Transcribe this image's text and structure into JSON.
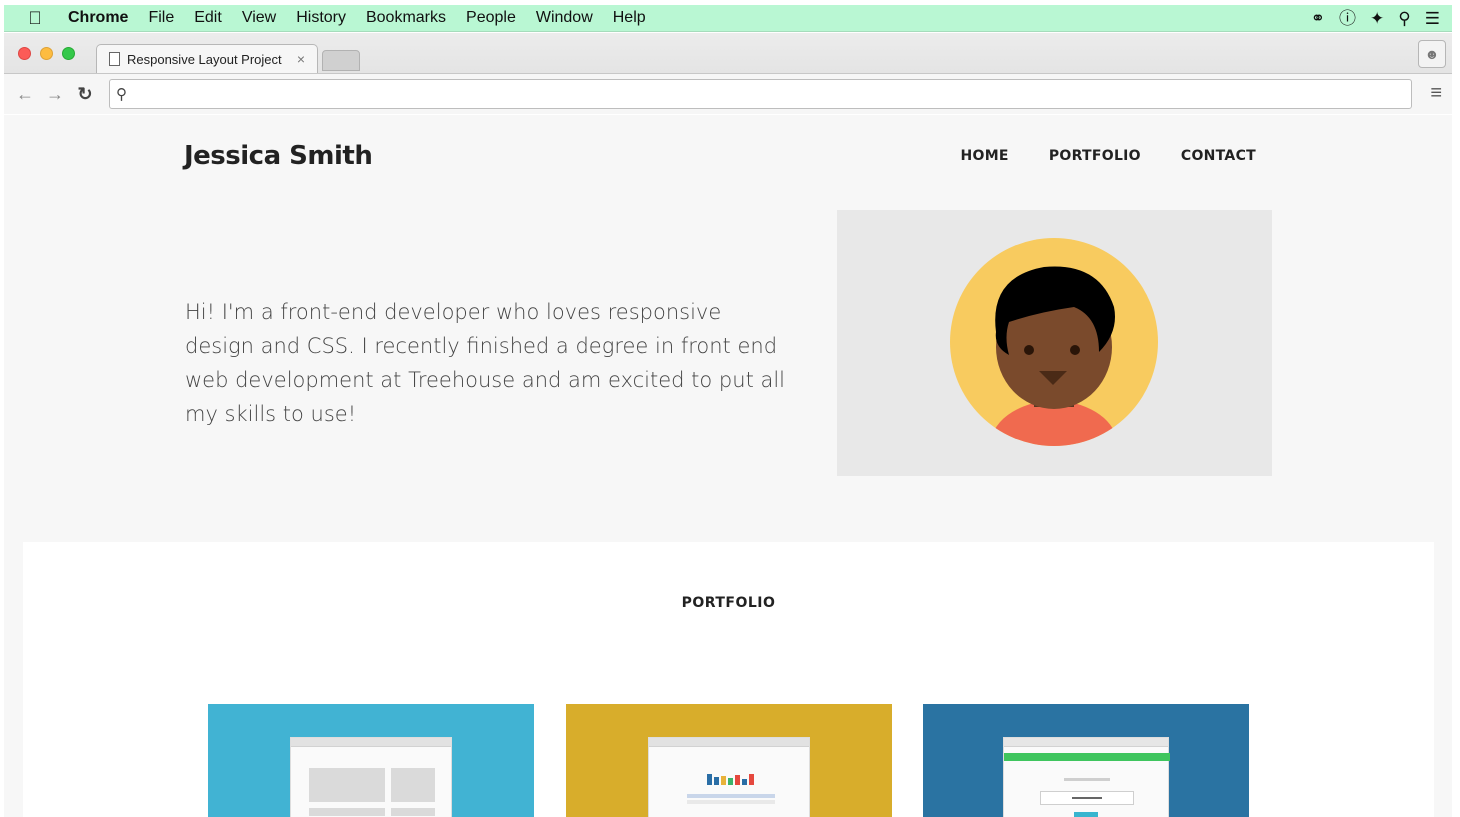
{
  "menubar": {
    "apple_icon": "apple-logo",
    "app_name": "Chrome",
    "items": [
      "File",
      "Edit",
      "View",
      "History",
      "Bookmarks",
      "People",
      "Window",
      "Help"
    ],
    "status_icons": [
      "creative-cloud-icon",
      "1password-icon",
      "dropbox-icon",
      "spotlight-search-icon",
      "notification-list-icon"
    ]
  },
  "browser": {
    "tab_title": "Responsive Layout Project",
    "tab_close": "×",
    "address_value": "",
    "address_placeholder": ""
  },
  "site": {
    "logo": "Jessica Smith",
    "nav": [
      "HOME",
      "PORTFOLIO",
      "CONTACT"
    ],
    "intro": "Hi! I'm a front-end developer who loves responsive design and CSS. I recently finished a degree in front end web development at Treehouse and am excited to put all my skills to use!",
    "portfolio_title": "PORTFOLIO",
    "cards": [
      {
        "color": "#41b3d3"
      },
      {
        "color": "#d8ad2b"
      },
      {
        "color": "#2a73a2"
      }
    ]
  },
  "colors": {
    "menubar_bg": "#b9f7d3",
    "avatar_bg": "#f8cb5f",
    "skin": "#7a4a2c",
    "hair": "#000000",
    "shirt": "#f06a4f"
  }
}
